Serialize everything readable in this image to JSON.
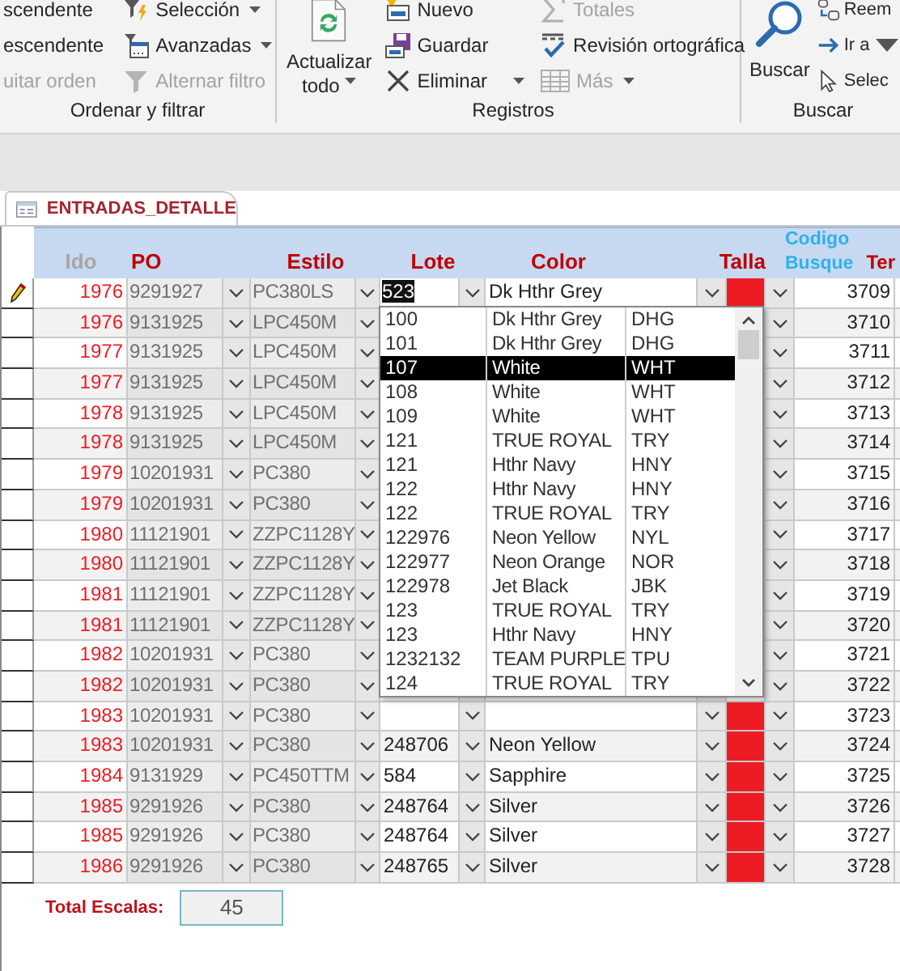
{
  "ribbon": {
    "groups": [
      {
        "label": "Ordenar y filtrar",
        "items": [
          {
            "kind": "small",
            "label": "scendente",
            "disabled": false,
            "menu": false
          },
          {
            "kind": "small",
            "label": "escendente",
            "disabled": false,
            "menu": false
          },
          {
            "kind": "small",
            "label": "uitar orden",
            "disabled": true,
            "menu": false
          },
          {
            "kind": "small",
            "label": "Selección",
            "disabled": false,
            "menu": true
          },
          {
            "kind": "small",
            "label": "Avanzadas",
            "disabled": false,
            "menu": true
          },
          {
            "kind": "small",
            "label": "Alternar filtro",
            "disabled": true,
            "menu": false
          }
        ]
      },
      {
        "label": "Registros",
        "items": [
          {
            "kind": "large",
            "label": "Actualizar todo",
            "disabled": false,
            "menu": true
          },
          {
            "kind": "small",
            "label": "Nuevo",
            "disabled": false,
            "menu": false
          },
          {
            "kind": "small",
            "label": "Guardar",
            "disabled": false,
            "menu": false
          },
          {
            "kind": "small",
            "label": "Eliminar",
            "disabled": false,
            "menu": true
          },
          {
            "kind": "small",
            "label": "Totales",
            "disabled": true,
            "menu": false
          },
          {
            "kind": "small",
            "label": "Revisión ortográfica",
            "disabled": false,
            "menu": false
          },
          {
            "kind": "small",
            "label": "Más",
            "disabled": true,
            "menu": true
          }
        ]
      },
      {
        "label": "Buscar",
        "items": [
          {
            "kind": "large",
            "label": "Buscar",
            "disabled": false,
            "menu": false
          },
          {
            "kind": "small",
            "label": "Reem",
            "disabled": false,
            "menu": false
          },
          {
            "kind": "small",
            "label": "Ir a",
            "disabled": false,
            "menu": true
          },
          {
            "kind": "small",
            "label": "Selec",
            "disabled": false,
            "menu": false
          }
        ]
      }
    ]
  },
  "tab": {
    "label": "ENTRADAS_DETALLE",
    "selected": true
  },
  "columns": [
    {
      "label": "Ido",
      "color": "#a6a6a6"
    },
    {
      "label": "PO",
      "color": "#c00000"
    },
    {
      "label": "Estilo",
      "color": "#c00000"
    },
    {
      "label": "Lote",
      "color": "#c00000"
    },
    {
      "label": "Color",
      "color": "#c00000"
    },
    {
      "label": "Talla",
      "color": "#c00000"
    },
    {
      "label": "Codigo Busque",
      "color": "#2eb2e8"
    },
    {
      "label": "Ter",
      "color": "#c00000"
    }
  ],
  "rows": [
    {
      "ido": "1976",
      "po": "9291927",
      "estilo": "PC380LS",
      "lote": "523",
      "color_name": "Dk Hthr Grey",
      "color": "#ed1c24",
      "codigo": "3709",
      "editing": true
    },
    {
      "ido": "1976",
      "po": "9131925",
      "estilo": "LPC450M",
      "codigo": "3710",
      "editing": false
    },
    {
      "ido": "1977",
      "po": "9131925",
      "estilo": "LPC450M",
      "codigo": "3711",
      "editing": false
    },
    {
      "ido": "1977",
      "po": "9131925",
      "estilo": "LPC450M",
      "codigo": "3712",
      "editing": false
    },
    {
      "ido": "1978",
      "po": "9131925",
      "estilo": "LPC450M",
      "codigo": "3713",
      "editing": false
    },
    {
      "ido": "1978",
      "po": "9131925",
      "estilo": "LPC450M",
      "codigo": "3714",
      "editing": false
    },
    {
      "ido": "1979",
      "po": "10201931",
      "estilo": "PC380",
      "codigo": "3715",
      "editing": false
    },
    {
      "ido": "1979",
      "po": "10201931",
      "estilo": "PC380",
      "codigo": "3716",
      "editing": false
    },
    {
      "ido": "1980",
      "po": "11121901",
      "estilo": "ZZPC1128Y",
      "codigo": "3717",
      "editing": false
    },
    {
      "ido": "1980",
      "po": "11121901",
      "estilo": "ZZPC1128Y",
      "codigo": "3718",
      "editing": false
    },
    {
      "ido": "1981",
      "po": "11121901",
      "estilo": "ZZPC1128Y",
      "codigo": "3719",
      "editing": false
    },
    {
      "ido": "1981",
      "po": "11121901",
      "estilo": "ZZPC1128Y",
      "codigo": "3720",
      "editing": false
    },
    {
      "ido": "1982",
      "po": "10201931",
      "estilo": "PC380",
      "codigo": "3721",
      "editing": false
    },
    {
      "ido": "1982",
      "po": "10201931",
      "estilo": "PC380",
      "codigo": "3722",
      "editing": false
    },
    {
      "ido": "1983",
      "po": "10201931",
      "estilo": "PC380",
      "color": "#ed1c24",
      "codigo": "3723",
      "editing": false
    },
    {
      "ido": "1983",
      "po": "10201931",
      "estilo": "PC380",
      "lote": "248706",
      "color_name": "Neon Yellow",
      "color": "#ed1c24",
      "codigo": "3724",
      "editing": false
    },
    {
      "ido": "1984",
      "po": "9131929",
      "estilo": "PC450TTM",
      "lote": "584",
      "color_name": "Sapphire",
      "color": "#ed1c24",
      "codigo": "3725",
      "editing": false
    },
    {
      "ido": "1985",
      "po": "9291926",
      "estilo": "PC380",
      "lote": "248764",
      "color_name": "Silver",
      "color": "#ed1c24",
      "codigo": "3726",
      "editing": false
    },
    {
      "ido": "1985",
      "po": "9291926",
      "estilo": "PC380",
      "lote": "248764",
      "color_name": "Silver",
      "color": "#ed1c24",
      "codigo": "3727",
      "editing": false
    },
    {
      "ido": "1986",
      "po": "9291926",
      "estilo": "PC380",
      "lote": "248765",
      "color_name": "Silver",
      "color": "#ed1c24",
      "codigo": "3728",
      "editing": false
    }
  ],
  "lote_dropdown": {
    "items": [
      {
        "lote": "100",
        "color_name": "Dk Hthr Grey",
        "code": "DHG",
        "selected": false
      },
      {
        "lote": "101",
        "color_name": "Dk Hthr Grey",
        "code": "DHG",
        "selected": false
      },
      {
        "lote": "107",
        "color_name": "White",
        "code": "WHT",
        "selected": true
      },
      {
        "lote": "108",
        "color_name": "White",
        "code": "WHT",
        "selected": false
      },
      {
        "lote": "109",
        "color_name": "White",
        "code": "WHT",
        "selected": false
      },
      {
        "lote": "121",
        "color_name": "TRUE ROYAL",
        "code": "TRY",
        "selected": false
      },
      {
        "lote": "121",
        "color_name": "Hthr Navy",
        "code": "HNY",
        "selected": false
      },
      {
        "lote": "122",
        "color_name": "Hthr Navy",
        "code": "HNY",
        "selected": false
      },
      {
        "lote": "122",
        "color_name": "TRUE ROYAL",
        "code": "TRY",
        "selected": false
      },
      {
        "lote": "122976",
        "color_name": "Neon Yellow",
        "code": "NYL",
        "selected": false
      },
      {
        "lote": "122977",
        "color_name": "Neon Orange",
        "code": "NOR",
        "selected": false
      },
      {
        "lote": "122978",
        "color_name": "Jet Black",
        "code": "JBK",
        "selected": false
      },
      {
        "lote": "123",
        "color_name": "TRUE ROYAL",
        "code": "TRY",
        "selected": false
      },
      {
        "lote": "123",
        "color_name": "Hthr Navy",
        "code": "HNY",
        "selected": false
      },
      {
        "lote": "1232132",
        "color_name": "TEAM PURPLE",
        "code": "TPU",
        "selected": false
      },
      {
        "lote": "124",
        "color_name": "TRUE ROYAL",
        "code": "TRY",
        "selected": false
      }
    ]
  },
  "total": {
    "label": "Total Escalas:",
    "value": "45"
  }
}
